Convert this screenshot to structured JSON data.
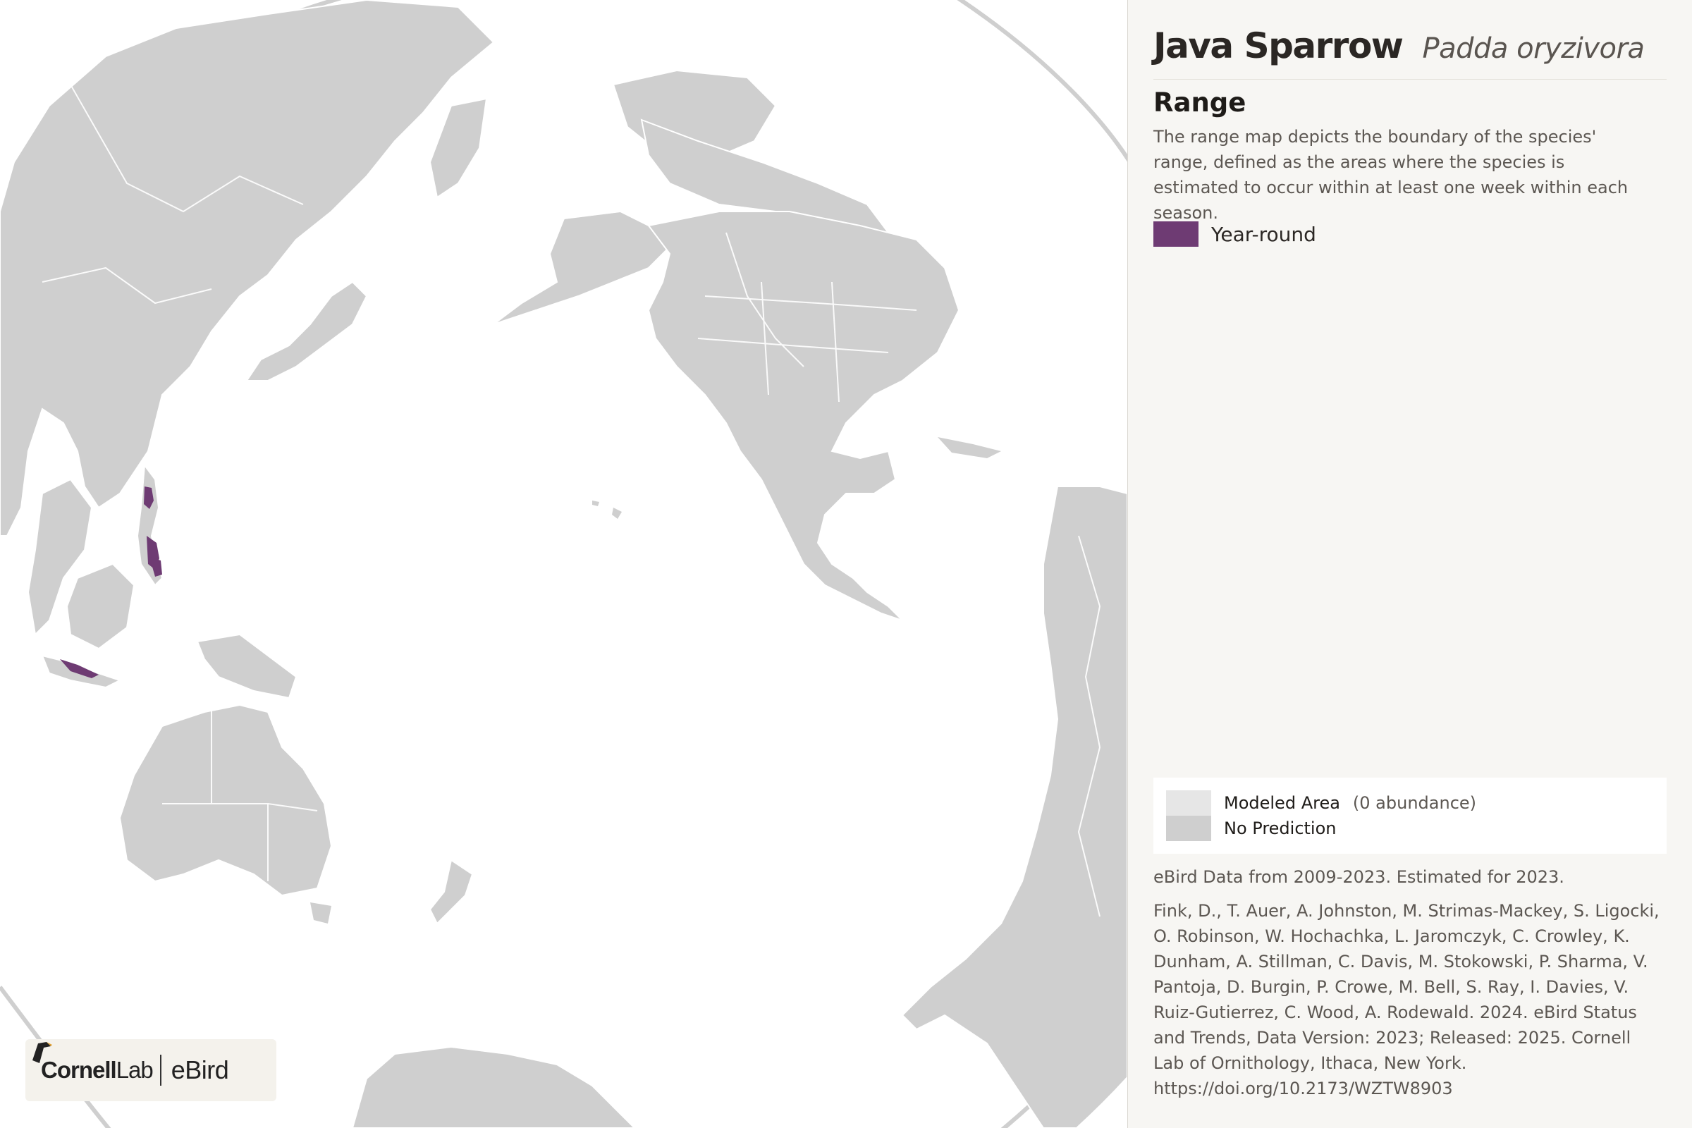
{
  "species": {
    "common_name": "Java Sparrow",
    "scientific_name": "Padda oryzivora"
  },
  "range": {
    "heading": "Range",
    "description": "The range map depicts the boundary of the species' range, defined as the areas where the species is estimated to occur within at least one week within each season."
  },
  "legend": {
    "year_round": {
      "label": "Year-round",
      "color": "#6e3b73"
    },
    "modeled_area": {
      "label": "Modeled Area",
      "note": "(0 abundance)",
      "color": "#e6e6e6"
    },
    "no_prediction": {
      "label": "No Prediction",
      "color": "#cfcfcf"
    }
  },
  "data_note": "eBird Data from 2009-2023. Estimated for 2023.",
  "citation": "Fink, D., T. Auer, A. Johnston, M. Strimas-Mackey, S. Ligocki, O. Robinson, W. Hochachka, L. Jaromczyk, C. Crowley, K. Dunham, A. Stillman, C. Davis, M. Stokowski, P. Sharma, V. Pantoja, D. Burgin, P. Crowe, M. Bell, S. Ray, I. Davies, V. Ruiz-Gutierrez, C. Wood, A. Rodewald. 2024. eBird Status and Trends, Data Version: 2023; Released: 2025. Cornell Lab of Ornithology, Ithaca, New York. https://doi.org/10.2173/WZTW8903",
  "logo": {
    "cornell_bold": "Cornell",
    "cornell_light": "Lab",
    "ebird": "eBird"
  },
  "map": {
    "land_color": "#cfcfcf",
    "ocean_color": "#ffffff",
    "border_color": "#ffffff"
  }
}
